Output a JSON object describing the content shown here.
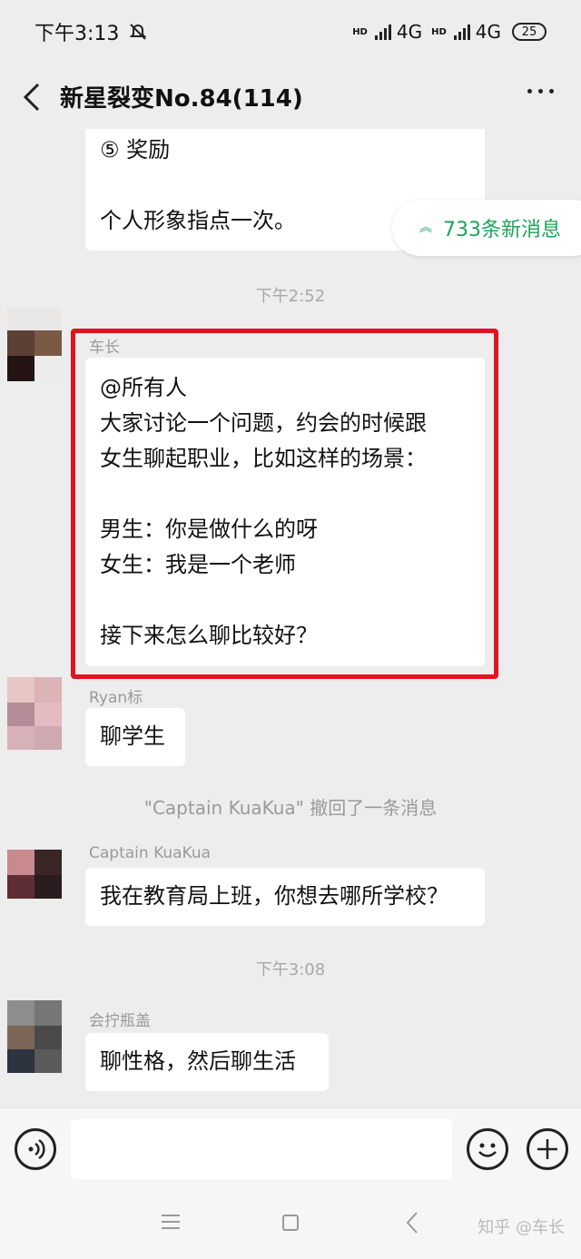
{
  "status_bar": {
    "time": "下午3:13",
    "network_1": "4G",
    "network_2": "4G",
    "battery": "25",
    "hd_label": "HD"
  },
  "header": {
    "title": "新星裂变No.84(114)"
  },
  "new_messages_pill": "733条新消息",
  "messages": {
    "reward": {
      "lines": [
        "⑤ 奖励",
        "",
        "个人形象指点一次。"
      ]
    },
    "timestamp_1": "下午2:52",
    "msg_1": {
      "sender": "车长",
      "lines": [
        "@所有人",
        "大家讨论一个问题，约会的时候跟",
        "女生聊起职业，比如这样的场景：",
        "",
        "男生：你是做什么的呀",
        "女生：我是一个老师",
        "",
        "接下来怎么聊比较好？"
      ]
    },
    "msg_2": {
      "sender": "Ryan标",
      "text": "聊学生"
    },
    "recall_notice": "\"Captain KuaKua\" 撤回了一条消息",
    "msg_3": {
      "sender": "Captain KuaKua",
      "text": "我在教育局上班，你想去哪所学校？"
    },
    "timestamp_2": "下午3:08",
    "msg_4": {
      "sender": "会拧瓶盖",
      "text": "聊性格，然后聊生活"
    }
  },
  "input": {
    "placeholder": ""
  },
  "watermark": "知乎 @车长",
  "colors": {
    "background": "#ededed",
    "bubble": "#ffffff",
    "highlight": "#e0141e",
    "accent_green": "#1ea35a"
  }
}
